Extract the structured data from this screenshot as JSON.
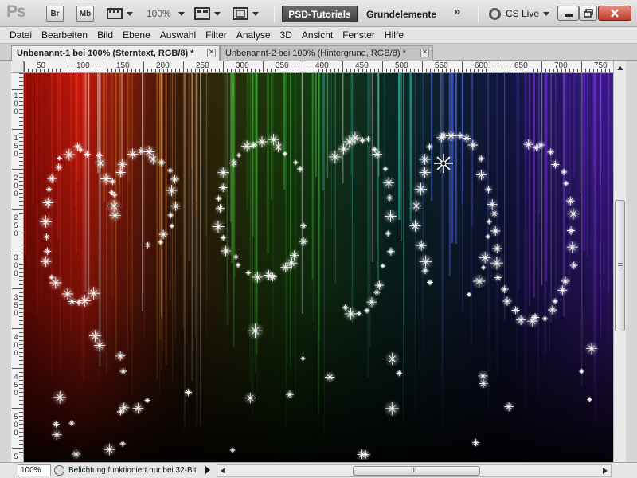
{
  "appbar": {
    "logo": "Ps",
    "bridge_label": "Br",
    "minibridge_label": "Mb",
    "zoom": "100%",
    "workspace_active": "PSD-Tutorials",
    "workspace_other": "Grundelemente",
    "more": "»",
    "cslive": "CS Live"
  },
  "menu": [
    "Datei",
    "Bearbeiten",
    "Bild",
    "Ebene",
    "Auswahl",
    "Filter",
    "Analyse",
    "3D",
    "Ansicht",
    "Fenster",
    "Hilfe"
  ],
  "tabs": [
    {
      "label": "Unbenannt-1 bei 100% (Sterntext, RGB/8) *",
      "close": "✕",
      "active": true
    },
    {
      "label": "Unbenannt-2 bei 100% (Hintergrund, RGB/8) *",
      "close": "✕",
      "active": false
    }
  ],
  "ruler": {
    "top_labels": [
      "50",
      "100",
      "150",
      "200",
      "250",
      "300",
      "350",
      "400",
      "450",
      "500",
      "550",
      "600",
      "650",
      "700",
      "750"
    ],
    "left_labels": [
      "1",
      "0",
      "0",
      "1",
      "5",
      "0",
      "2",
      "0",
      "0",
      "2",
      "5",
      "0",
      "3",
      "0",
      "0",
      "3",
      "5",
      "0",
      "4",
      "0",
      "0",
      "4",
      "5",
      "0",
      "5",
      "0",
      "0",
      "5"
    ]
  },
  "status": {
    "zoom": "100%",
    "message": "Belichtung funktioniert nur bei 32-Bit",
    "scroll_grip": "III"
  },
  "colors": {
    "red": "#ff2a1a",
    "orange": "#e07a22",
    "green": "#3ecf3a",
    "teal": "#37d6c0",
    "blue": "#4f6bff",
    "purple": "#8a3cff",
    "star": "#ffffff"
  },
  "icons": {
    "minimize": "minimize-icon",
    "restore": "restore-icon",
    "close": "close-icon"
  }
}
